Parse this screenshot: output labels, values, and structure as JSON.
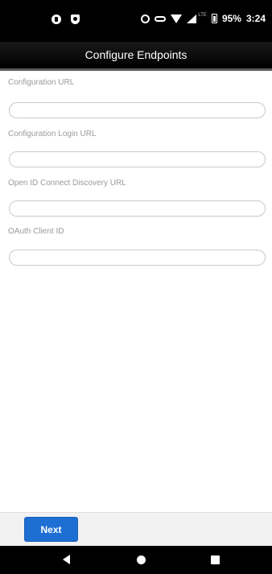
{
  "status_bar": {
    "battery": "95%",
    "time": "3:24",
    "network": "LTE"
  },
  "header": {
    "title": "Configure Endpoints"
  },
  "form": {
    "fields": [
      {
        "label": "Configuration URL",
        "value": "",
        "placeholder": ""
      },
      {
        "label": "Configuration Login URL",
        "value": "",
        "placeholder": ""
      },
      {
        "label": "Open ID Connect Discovery URL",
        "value": "",
        "placeholder": ""
      },
      {
        "label": "OAuth Client ID",
        "value": "",
        "placeholder": ""
      }
    ]
  },
  "footer": {
    "next_label": "Next"
  },
  "nav": {
    "back_icon": "back-triangle",
    "home_icon": "home-circle",
    "recents_icon": "recents-square"
  },
  "colors": {
    "status_bar_bg": "#000000",
    "header_bg": "#000000",
    "accent": "#1e6fd4",
    "label_text": "#9a9a9a"
  }
}
